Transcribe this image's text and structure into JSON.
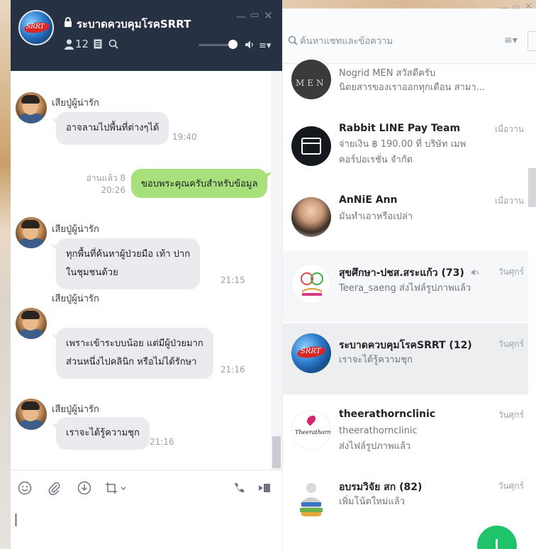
{
  "chat": {
    "title": "ระบาดควบคุมโรคSRRT",
    "member_count": "12",
    "messages": [
      {
        "sender": "เสียปู่ผู้น่ารัก",
        "lines": [
          "อาจลามไปพื้นที่ต่างๆได้"
        ],
        "time": "19:40"
      },
      {
        "sender": "",
        "lines": [
          "ขอบพระคุณครับสำหรับข้อมูล"
        ],
        "read": "อ่านแล้ว 8",
        "time": "20:26",
        "outgoing": true
      },
      {
        "sender": "เสียปู่ผู้น่ารัก",
        "lines": [
          "ทุกพื้นที่ค้นหาผู้ป่วยมือ เท้า ปาก",
          "ในชุมชนด้วย"
        ],
        "time": "21:15"
      },
      {
        "sender": "เสียปู่ผู้น่ารัก",
        "lines": [
          "เพราะเข้าระบบน้อย แต่มีผู้ป่วยมาก",
          "ส่วนหนึ่งไปคลินิก หรือไม่ได้รักษา"
        ],
        "time": "21:16"
      },
      {
        "sender": "เสียปู่ผู้น่ารัก",
        "lines": [
          "เราจะได้รู้ความชุก"
        ],
        "time": "21:16"
      }
    ],
    "toolbar_icons": [
      "emoji-icon",
      "attach-icon",
      "download-icon",
      "crop-icon",
      "phone-icon",
      "video-icon"
    ]
  },
  "list": {
    "search_placeholder": "ค้นหาแชทและข้อความ",
    "rows": [
      {
        "name": "Nogrid MEN",
        "msg1": "Nogrid MEN สวัสดีครับ",
        "msg2": "นิตยสารของเราออกทุกเดือน สามา...",
        "date": ""
      },
      {
        "name": "Rabbit LINE Pay Team",
        "msg1": "จ่ายเงิน ฿ 190.00 ที่ บริษัท เมพ",
        "msg2": "คอร์ปอเรชั่น จำกัด",
        "date": "เมื่อวาน"
      },
      {
        "name": "AnNiE Ann",
        "msg1": "มันทำเอาหรือเปล่า",
        "msg2": "",
        "date": "เมื่อวาน"
      },
      {
        "name": "สุขศึกษา-ปชส.สระแก้ว (73)",
        "msg1": "Teera_saeng ส่งไฟล์รูปภาพแล้ว",
        "msg2": "",
        "date": "วันศุกร์"
      },
      {
        "name": "ระบาดควบคุมโรคSRRT (12)",
        "msg1": "เราจะได้รู้ความชุก",
        "msg2": "",
        "date": "วันศุกร์"
      },
      {
        "name": "theerathornclinic",
        "msg1": "theerathornclinic",
        "msg2": "ส่งไฟล์รูปภาพแล้ว",
        "date": "วันศุกร์"
      },
      {
        "name": "อบรมวิจัย สก (82)",
        "msg1": "เพิ่มโน้ตใหม่แล้ว",
        "msg2": "",
        "date": "วันศุกร์"
      }
    ]
  },
  "colors": {
    "header": "#263243",
    "bubble_in": "#e9ebee",
    "bubble_out": "#a8e07c",
    "fab": "#1fc46a"
  }
}
